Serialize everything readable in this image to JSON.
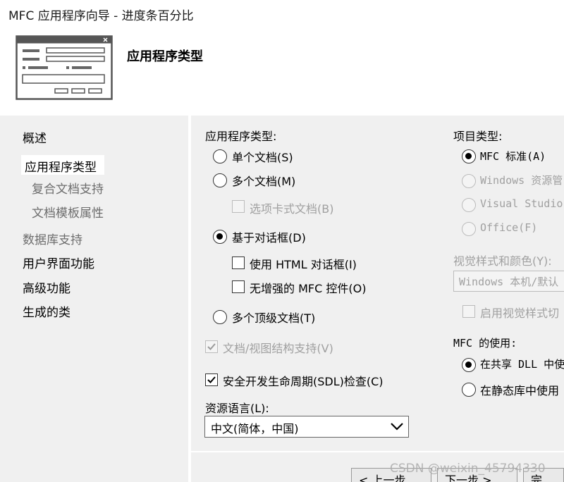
{
  "window": {
    "title": "MFC 应用程序向导 - 进度条百分比"
  },
  "header": {
    "title": "应用程序类型"
  },
  "nav": {
    "items": [
      {
        "label": "概述"
      },
      {
        "label": "应用程序类型"
      },
      {
        "label": "复合文档支持"
      },
      {
        "label": "文档模板属性"
      },
      {
        "label": "数据库支持"
      },
      {
        "label": "用户界面功能"
      },
      {
        "label": "高级功能"
      },
      {
        "label": "生成的类"
      }
    ]
  },
  "app_type": {
    "label": "应用程序类型:",
    "single_doc": "单个文档(S)",
    "multi_doc": "多个文档(M)",
    "tabbed_docs": "选项卡式文档(B)",
    "dialog_based": "基于对话框(D)",
    "use_html_dialog": "使用 HTML 对话框(I)",
    "no_enhanced_mfc": "无增强的 MFC 控件(O)",
    "multi_top_level": "多个顶级文档(T)"
  },
  "doc_view": {
    "label": "文档/视图结构支持(V)"
  },
  "sdl": {
    "label": "安全开发生命周期(SDL)检查(C)"
  },
  "resource_lang": {
    "label": "资源语言(L):",
    "value": "中文(简体，中国)"
  },
  "project_type": {
    "label": "项目类型:",
    "mfc_standard": "MFC 标准(A)",
    "windows_explorer": "Windows 资源管",
    "visual_studio": "Visual Studio",
    "office": "Office(F)"
  },
  "visual_style": {
    "label": "视觉样式和颜色(Y):",
    "value": "Windows 本机/默认",
    "enable_switch": "启用视觉样式切"
  },
  "mfc_use": {
    "label": "MFC 的使用:",
    "shared_dll": "在共享 DLL 中使",
    "static_lib": "在静态库中使用"
  },
  "buttons": {
    "prev": "< 上一步",
    "next": "下一步 >",
    "finish": "完"
  },
  "watermark": "CSDN @weixin_45794330"
}
